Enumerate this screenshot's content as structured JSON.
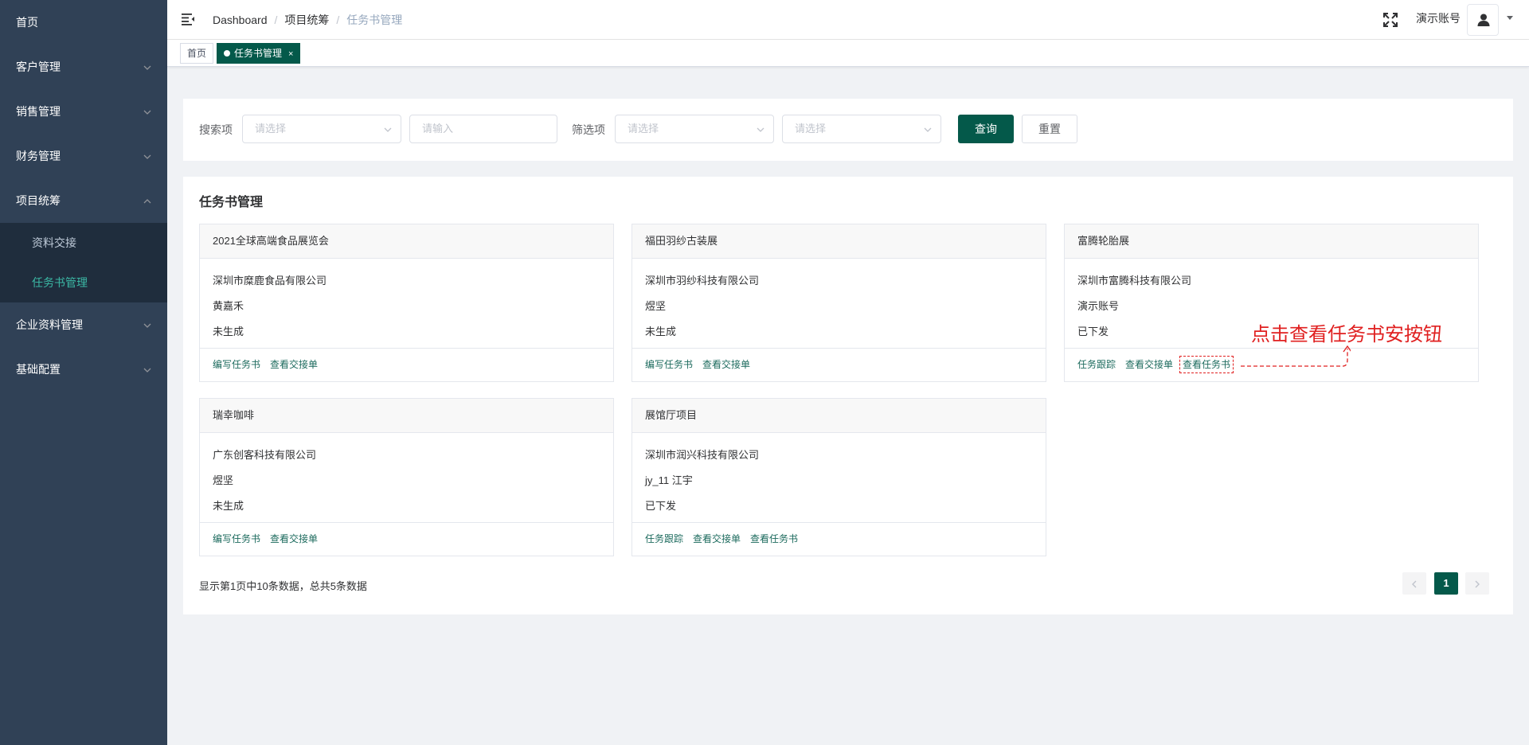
{
  "sidebar": {
    "items": [
      {
        "label": "首页"
      },
      {
        "label": "客户管理"
      },
      {
        "label": "销售管理"
      },
      {
        "label": "财务管理"
      },
      {
        "label": "项目统筹",
        "children": [
          {
            "label": "资料交接"
          },
          {
            "label": "任务书管理",
            "active": true
          }
        ]
      },
      {
        "label": "企业资料管理"
      },
      {
        "label": "基础配置"
      }
    ]
  },
  "header": {
    "breadcrumb": [
      "Dashboard",
      "项目统筹",
      "任务书管理"
    ],
    "user_name": "演示账号"
  },
  "tags": [
    {
      "label": "首页"
    },
    {
      "label": "任务书管理",
      "close": "×",
      "active": true
    }
  ],
  "search": {
    "search_label": "搜索项",
    "search_select_placeholder": "请选择",
    "search_input_placeholder": "请输入",
    "filter_label": "筛选项",
    "filter_select1_placeholder": "请选择",
    "filter_select2_placeholder": "请选择",
    "query_button": "查询",
    "reset_button": "重置"
  },
  "main": {
    "title": "任务书管理",
    "cards": [
      {
        "title": "2021全球高端食品展览会",
        "company": "深圳市糜鹿食品有限公司",
        "person": "黄嘉禾",
        "status": "未生成",
        "actions": [
          "编写任务书",
          "查看交接单"
        ]
      },
      {
        "title": "福田羽纱古装展",
        "company": "深圳市羽纱科技有限公司",
        "person": "煜坚",
        "status": "未生成",
        "actions": [
          "编写任务书",
          "查看交接单"
        ]
      },
      {
        "title": "富腾轮胎展",
        "company": "深圳市富腾科技有限公司",
        "person": "演示账号",
        "status": "已下发",
        "actions": [
          "任务跟踪",
          "查看交接单",
          "查看任务书"
        ]
      },
      {
        "title": "瑞幸咖啡",
        "company": "广东创客科技有限公司",
        "person": "煜坚",
        "status": "未生成",
        "actions": [
          "编写任务书",
          "查看交接单"
        ]
      },
      {
        "title": "展馆厅项目",
        "company": "深圳市润兴科技有限公司",
        "person": "jy_11 江宇",
        "status": "已下发",
        "actions": [
          "任务跟踪",
          "查看交接单",
          "查看任务书"
        ]
      }
    ],
    "pagination_text": "显示第1页中10条数据，总共5条数据",
    "current_page": "1"
  },
  "annotation": {
    "text": "点击查看任务书安按钮",
    "color": "#e02020"
  },
  "colors": {
    "sidebar_bg": "#304156",
    "accent": "#04594a",
    "link": "#1d6b5e"
  }
}
